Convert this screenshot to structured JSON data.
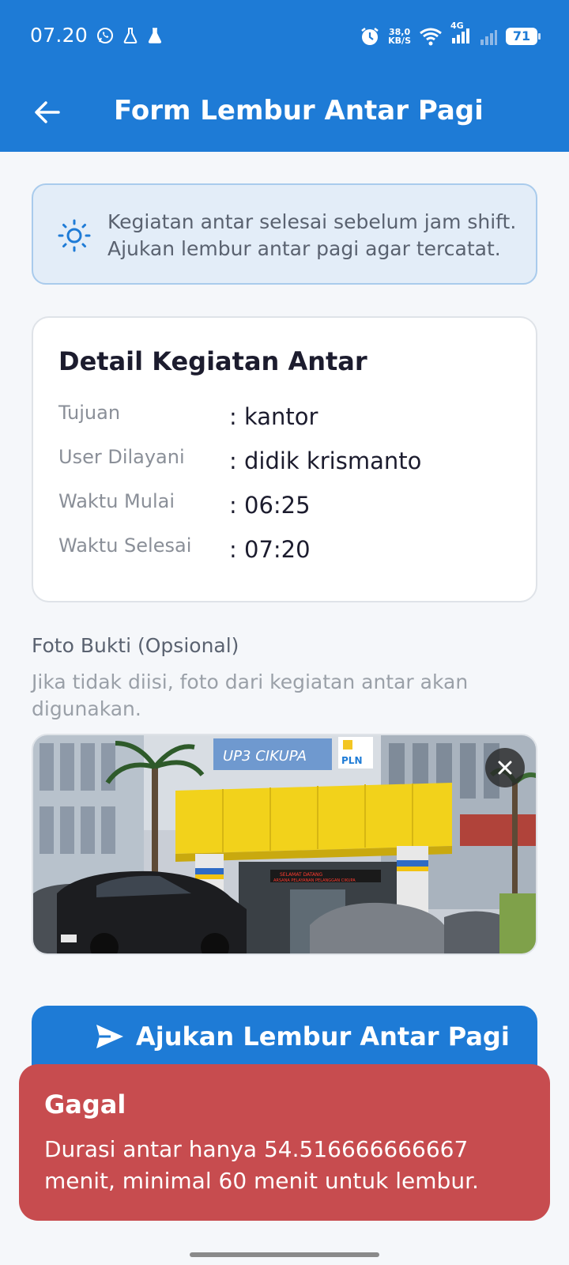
{
  "status_bar": {
    "time": "07.20",
    "net_speed_value": "38,0",
    "net_speed_unit": "KB/S",
    "network_type": "4G",
    "battery": "71",
    "icons": [
      "whatsapp-icon",
      "flask-icon",
      "flask-filled-icon",
      "alarm-icon",
      "wifi-icon",
      "signal-icon",
      "signal-weak-icon",
      "battery-icon"
    ]
  },
  "app_bar": {
    "title": "Form Lembur Antar Pagi",
    "back_icon": "arrow-left-icon"
  },
  "info": {
    "icon": "sun-icon",
    "text": "Kegiatan antar selesai sebelum jam shift. Ajukan lembur antar pagi agar tercatat."
  },
  "detail": {
    "title": "Detail Kegiatan Antar",
    "rows": [
      {
        "label": "Tujuan",
        "value": ": kantor"
      },
      {
        "label": "User Dilayani",
        "value": ": didik krismanto"
      },
      {
        "label": "Waktu Mulai",
        "value": ": 06:25"
      },
      {
        "label": "Waktu Selesai",
        "value": ": 07:20"
      }
    ]
  },
  "photo": {
    "label": "Foto Bukti (Opsional)",
    "hint": "Jika tidak diisi, foto dari kegiatan antar akan digunakan.",
    "sign_text": "UP3 CIKUPA",
    "logo_text": "PLN",
    "led_text_1": "SELAMAT DATANG",
    "led_text_2": "ARSANA PELAYANAN PELANGGAN CIKUPA",
    "close_icon": "close-icon"
  },
  "submit": {
    "label": "Ajukan Lembur Antar Pagi",
    "icon": "send-icon"
  },
  "snackbar": {
    "title": "Gagal",
    "message": "Durasi antar hanya 54.516666666667 menit, minimal 60 menit untuk lembur."
  },
  "colors": {
    "primary": "#1e7bd6",
    "error": "#c74c4f",
    "info_bg": "#e3edf8",
    "background": "#f5f7fa"
  }
}
